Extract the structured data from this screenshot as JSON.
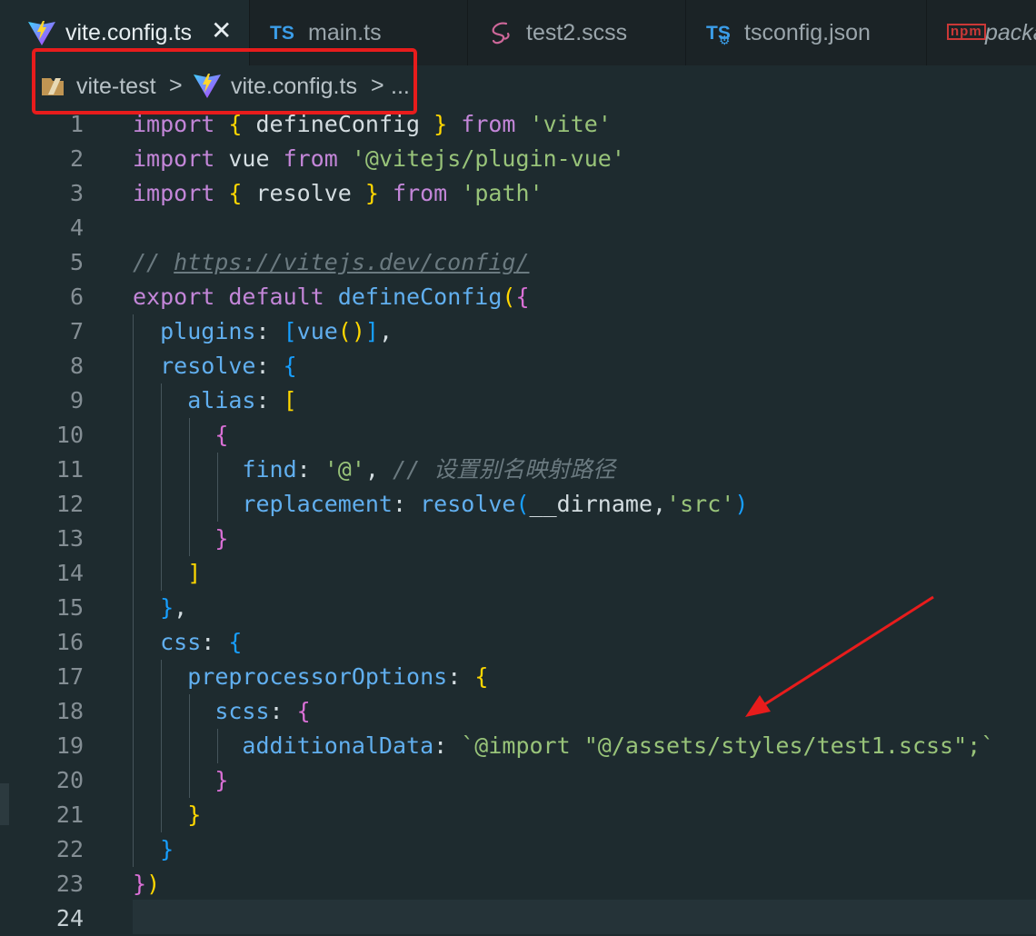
{
  "tabs": [
    {
      "label": "vite.config.ts",
      "icon": "vite-icon",
      "active": true,
      "close": "✕"
    },
    {
      "label": "main.ts",
      "icon": "typescript-icon",
      "icon_text": "TS"
    },
    {
      "label": "test2.scss",
      "icon": "sass-icon"
    },
    {
      "label": "tsconfig.json",
      "icon": "tsconfig-icon",
      "icon_text": "TS"
    },
    {
      "label": "packa",
      "icon": "npm-icon",
      "icon_text": "npm"
    }
  ],
  "breadcrumb": {
    "folder": "vite-test",
    "file": "vite.config.ts",
    "more": "...",
    "separator": ">"
  },
  "code": {
    "line_numbers": [
      "1",
      "2",
      "3",
      "4",
      "5",
      "6",
      "7",
      "8",
      "9",
      "10",
      "11",
      "12",
      "13",
      "14",
      "15",
      "16",
      "17",
      "18",
      "19",
      "20",
      "21",
      "22",
      "23",
      "24"
    ],
    "l1": {
      "import": "import",
      "ob": "{",
      "name": " defineConfig ",
      "cb": "}",
      "from": "from",
      "src": "'vite'"
    },
    "l2": {
      "import": "import",
      "name": " vue ",
      "from": "from",
      "src": "'@vitejs/plugin-vue'"
    },
    "l3": {
      "import": "import",
      "ob": "{",
      "name": " resolve ",
      "cb": "}",
      "from": "from",
      "src": "'path'"
    },
    "l5": {
      "comment": "// ",
      "url": "https://vitejs.dev/config/"
    },
    "l6": {
      "export": "export",
      "default": "default",
      "fn": "defineConfig",
      "op": "(",
      "ob": "{"
    },
    "l7": {
      "key": "plugins",
      "colon": ": ",
      "ob": "[",
      "fn": "vue",
      "par": "()",
      "cb": "]",
      "comma": ","
    },
    "l8": {
      "key": "resolve",
      "colon": ": ",
      "ob": "{"
    },
    "l9": {
      "key": "alias",
      "colon": ": ",
      "ob": "["
    },
    "l10": {
      "ob": "{"
    },
    "l11": {
      "key": "find",
      "colon": ": ",
      "val": "'@'",
      "comma": ", ",
      "comment": "// 设置别名映射路径"
    },
    "l12": {
      "key": "replacement",
      "colon": ": ",
      "fn": "resolve",
      "op": "(",
      "arg": "__dirname",
      "comma": ",",
      "val": "'src'",
      "cp": ")"
    },
    "l13": {
      "cb": "}"
    },
    "l14": {
      "cb": "]"
    },
    "l15": {
      "cb": "}",
      "comma": ","
    },
    "l16": {
      "key": "css",
      "colon": ": ",
      "ob": "{"
    },
    "l17": {
      "key": "preprocessorOptions",
      "colon": ": ",
      "ob": "{"
    },
    "l18": {
      "key": "scss",
      "colon": ": ",
      "ob": "{"
    },
    "l19": {
      "key": "additionalData",
      "colon": ": ",
      "val": "`@import \"@/assets/styles/test1.scss\";`"
    },
    "l20": {
      "cb": "}"
    },
    "l21": {
      "cb": "}"
    },
    "l22": {
      "cb": "}"
    },
    "l23": {
      "cb": "}",
      "cp": ")"
    }
  },
  "colors": {
    "annotation": "#e81c1c",
    "background": "#1e2b2f"
  }
}
